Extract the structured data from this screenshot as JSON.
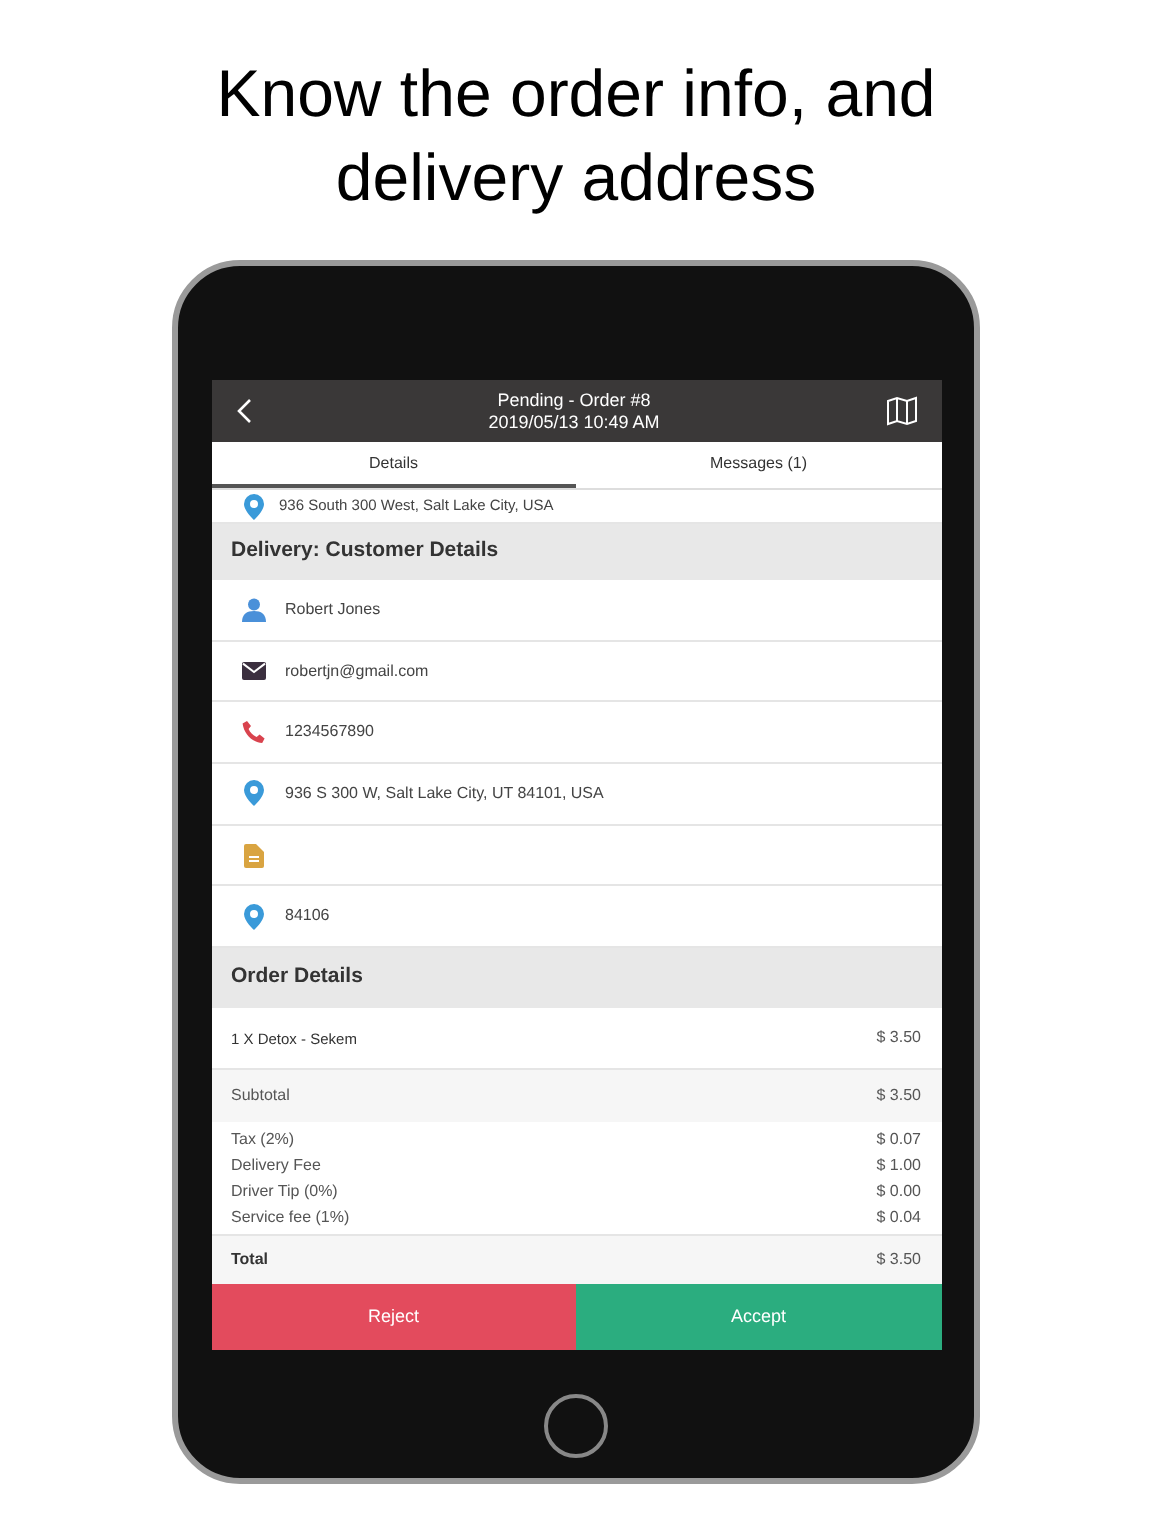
{
  "headline": "Know the order info, and delivery address",
  "header": {
    "title": "Pending - Order #8",
    "subtitle": "2019/05/13 10:49 AM"
  },
  "tabs": [
    {
      "label": "Details",
      "selected": true
    },
    {
      "label": "Messages (1)",
      "selected": false
    }
  ],
  "pickup_address": "936 South 300 West, Salt Lake City, USA",
  "customer_section": {
    "title": "Delivery: Customer Details",
    "rows": [
      {
        "kind": "person",
        "text": "Robert Jones"
      },
      {
        "kind": "email",
        "text": "robertjn@gmail.com"
      },
      {
        "kind": "phone",
        "text": "1234567890"
      },
      {
        "kind": "location",
        "text": "936 S 300 W, Salt Lake City, UT 84101, USA"
      },
      {
        "kind": "note"
      },
      {
        "kind": "location",
        "text": "84106"
      }
    ]
  },
  "order_section": {
    "title": "Order Details",
    "items": [
      {
        "name": "1 X Detox - Sekem",
        "price": "$ 3.50"
      }
    ],
    "subtotal": {
      "label": "Subtotal",
      "amount": "$ 3.50"
    },
    "fees": [
      {
        "label": "Tax (2%)",
        "amount": "$ 0.07"
      },
      {
        "label": "Delivery Fee",
        "amount": "$ 1.00"
      },
      {
        "label": "Driver Tip (0%)",
        "amount": "$ 0.00"
      },
      {
        "label": "Service fee (1%)",
        "amount": "$ 0.04"
      }
    ],
    "total": {
      "label": "Total",
      "amount": "$ 3.50"
    }
  },
  "actions": [
    {
      "kind": "reject",
      "label": "Reject"
    },
    {
      "kind": "accept",
      "label": "Accept"
    }
  ]
}
